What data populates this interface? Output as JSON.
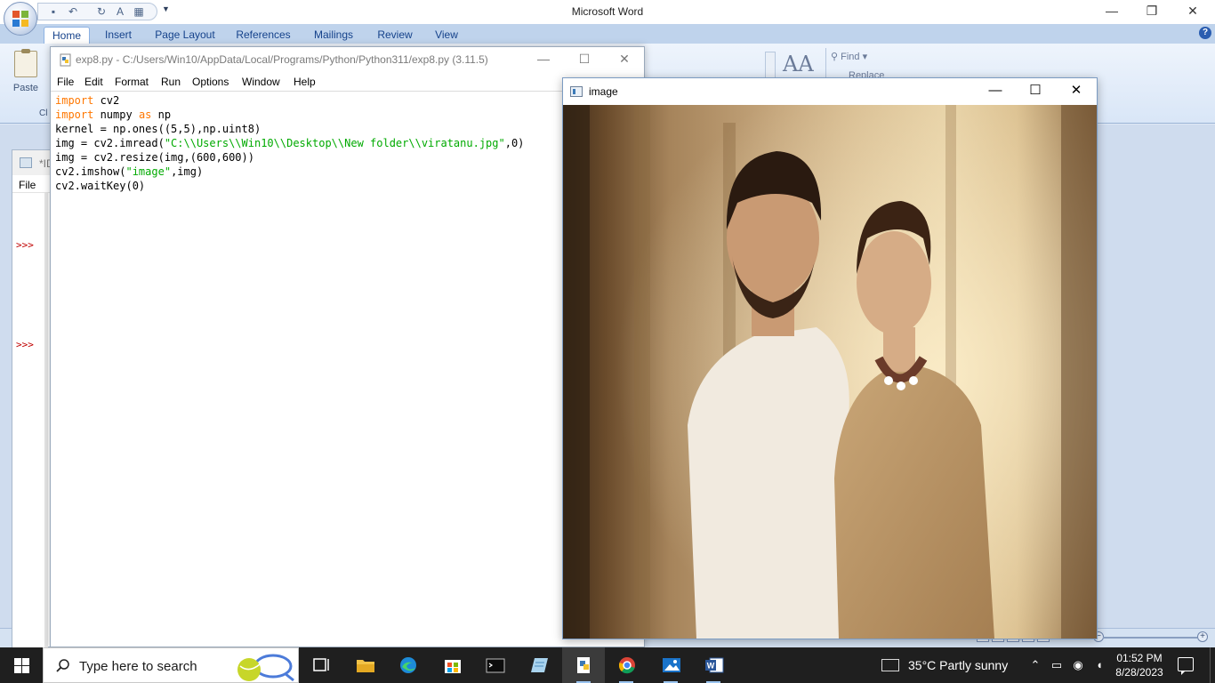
{
  "word": {
    "title": "Microsoft Word",
    "tabs": [
      "Home",
      "Insert",
      "Page Layout",
      "References",
      "Mailings",
      "Review",
      "View"
    ],
    "active_tab": "Home",
    "paste_label": "Paste",
    "clipboard_label": "Cl",
    "find_label": "Find",
    "replace_label": "Replace",
    "font_glyph": "AA"
  },
  "shell": {
    "title": "*ID",
    "file_menu": "File",
    "prompts": [
      ">>>",
      ">>>"
    ]
  },
  "editor": {
    "title": "exp8.py - C:/Users/Win10/AppData/Local/Programs/Python/Python311/exp8.py (3.11.5)",
    "menu": [
      "File",
      "Edit",
      "Format",
      "Run",
      "Options",
      "Window",
      "Help"
    ],
    "code": {
      "l1_kw": "import",
      "l1_tx": " cv2",
      "l2_kw": "import",
      "l2_tx1": " numpy ",
      "l2_kw2": "as",
      "l2_tx2": " np",
      "l3": "kernel = np.ones((5,5),np.uint8)",
      "l4_tx1": "img = cv2.imread(",
      "l4_str": "\"C:\\\\Users\\\\Win10\\\\Desktop\\\\New folder\\\\viratanu.jpg\"",
      "l4_tx2": ",0)",
      "l5": "img = cv2.resize(img,(600,600))",
      "l6_tx1": "cv2.imshow(",
      "l6_str": "\"image\"",
      "l6_tx2": ",img)",
      "l7": "cv2.waitKey(0)"
    },
    "colors": {
      "keyword": "#ff7700",
      "string": "#00aa00"
    }
  },
  "image_window": {
    "title": "image"
  },
  "taskbar": {
    "search_placeholder": "Type here to search",
    "apps": [
      "task-view",
      "file-explorer",
      "edge",
      "store",
      "terminal",
      "notepad",
      "python-idle",
      "chrome",
      "photos",
      "word"
    ],
    "weather": "35°C  Partly sunny",
    "time": "01:52 PM",
    "date": "8/28/2023"
  }
}
